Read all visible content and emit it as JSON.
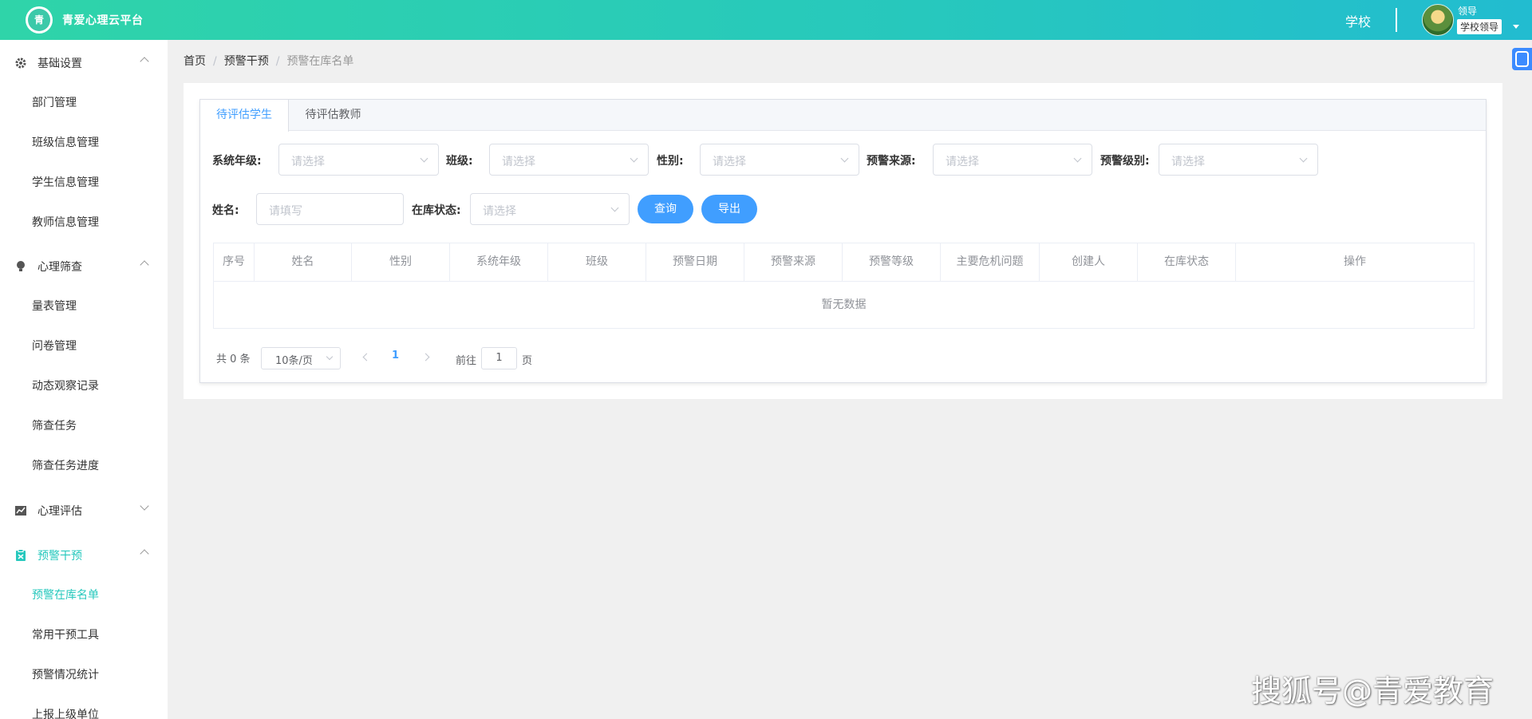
{
  "header": {
    "logo_text": "青",
    "app_title": "青爱心理云平台",
    "school_link": "学校",
    "user_name": "领导",
    "user_role": "学校领导"
  },
  "sidebar": {
    "groups": [
      {
        "label": "基础设置",
        "icon": "gear-icon",
        "expanded": true,
        "items": [
          "部门管理",
          "班级信息管理",
          "学生信息管理",
          "教师信息管理"
        ]
      },
      {
        "label": "心理筛查",
        "icon": "bulb-icon",
        "expanded": true,
        "items": [
          "量表管理",
          "问卷管理",
          "动态观察记录",
          "筛查任务",
          "筛查任务进度"
        ]
      },
      {
        "label": "心理评估",
        "icon": "chart-icon",
        "expanded": false,
        "items": []
      },
      {
        "label": "预警干预",
        "icon": "clipboard-icon",
        "expanded": true,
        "items": [
          "预警在库名单",
          "常用干预工具",
          "预警情况统计",
          "上报上级单位"
        ]
      }
    ],
    "active_item": "预警在库名单"
  },
  "breadcrumb": [
    "首页",
    "预警干预",
    "预警在库名单"
  ],
  "tabs": [
    "待评估学生",
    "待评估教师"
  ],
  "filters": {
    "grade_label": "系统年级:",
    "class_label": "班级:",
    "gender_label": "性别:",
    "source_label": "预警来源:",
    "level_label": "预警级别:",
    "name_label": "姓名:",
    "status_label": "在库状态:",
    "select_placeholder": "请选择",
    "input_placeholder": "请填写"
  },
  "buttons": {
    "query": "查询",
    "export": "导出"
  },
  "table": {
    "columns": [
      "序号",
      "姓名",
      "性别",
      "系统年级",
      "班级",
      "预警日期",
      "预警来源",
      "预警等级",
      "主要危机问题",
      "创建人",
      "在库状态",
      "操作"
    ],
    "empty_text": "暂无数据"
  },
  "pagination": {
    "total_text": "共 0 条",
    "page_size": "10条/页",
    "current_page": "1",
    "goto_label": "前往",
    "goto_value": "1",
    "page_suffix": "页"
  },
  "watermark": "搜狐号@青爱教育",
  "colors": {
    "accent": "#27c8bd",
    "primary": "#409eff"
  }
}
